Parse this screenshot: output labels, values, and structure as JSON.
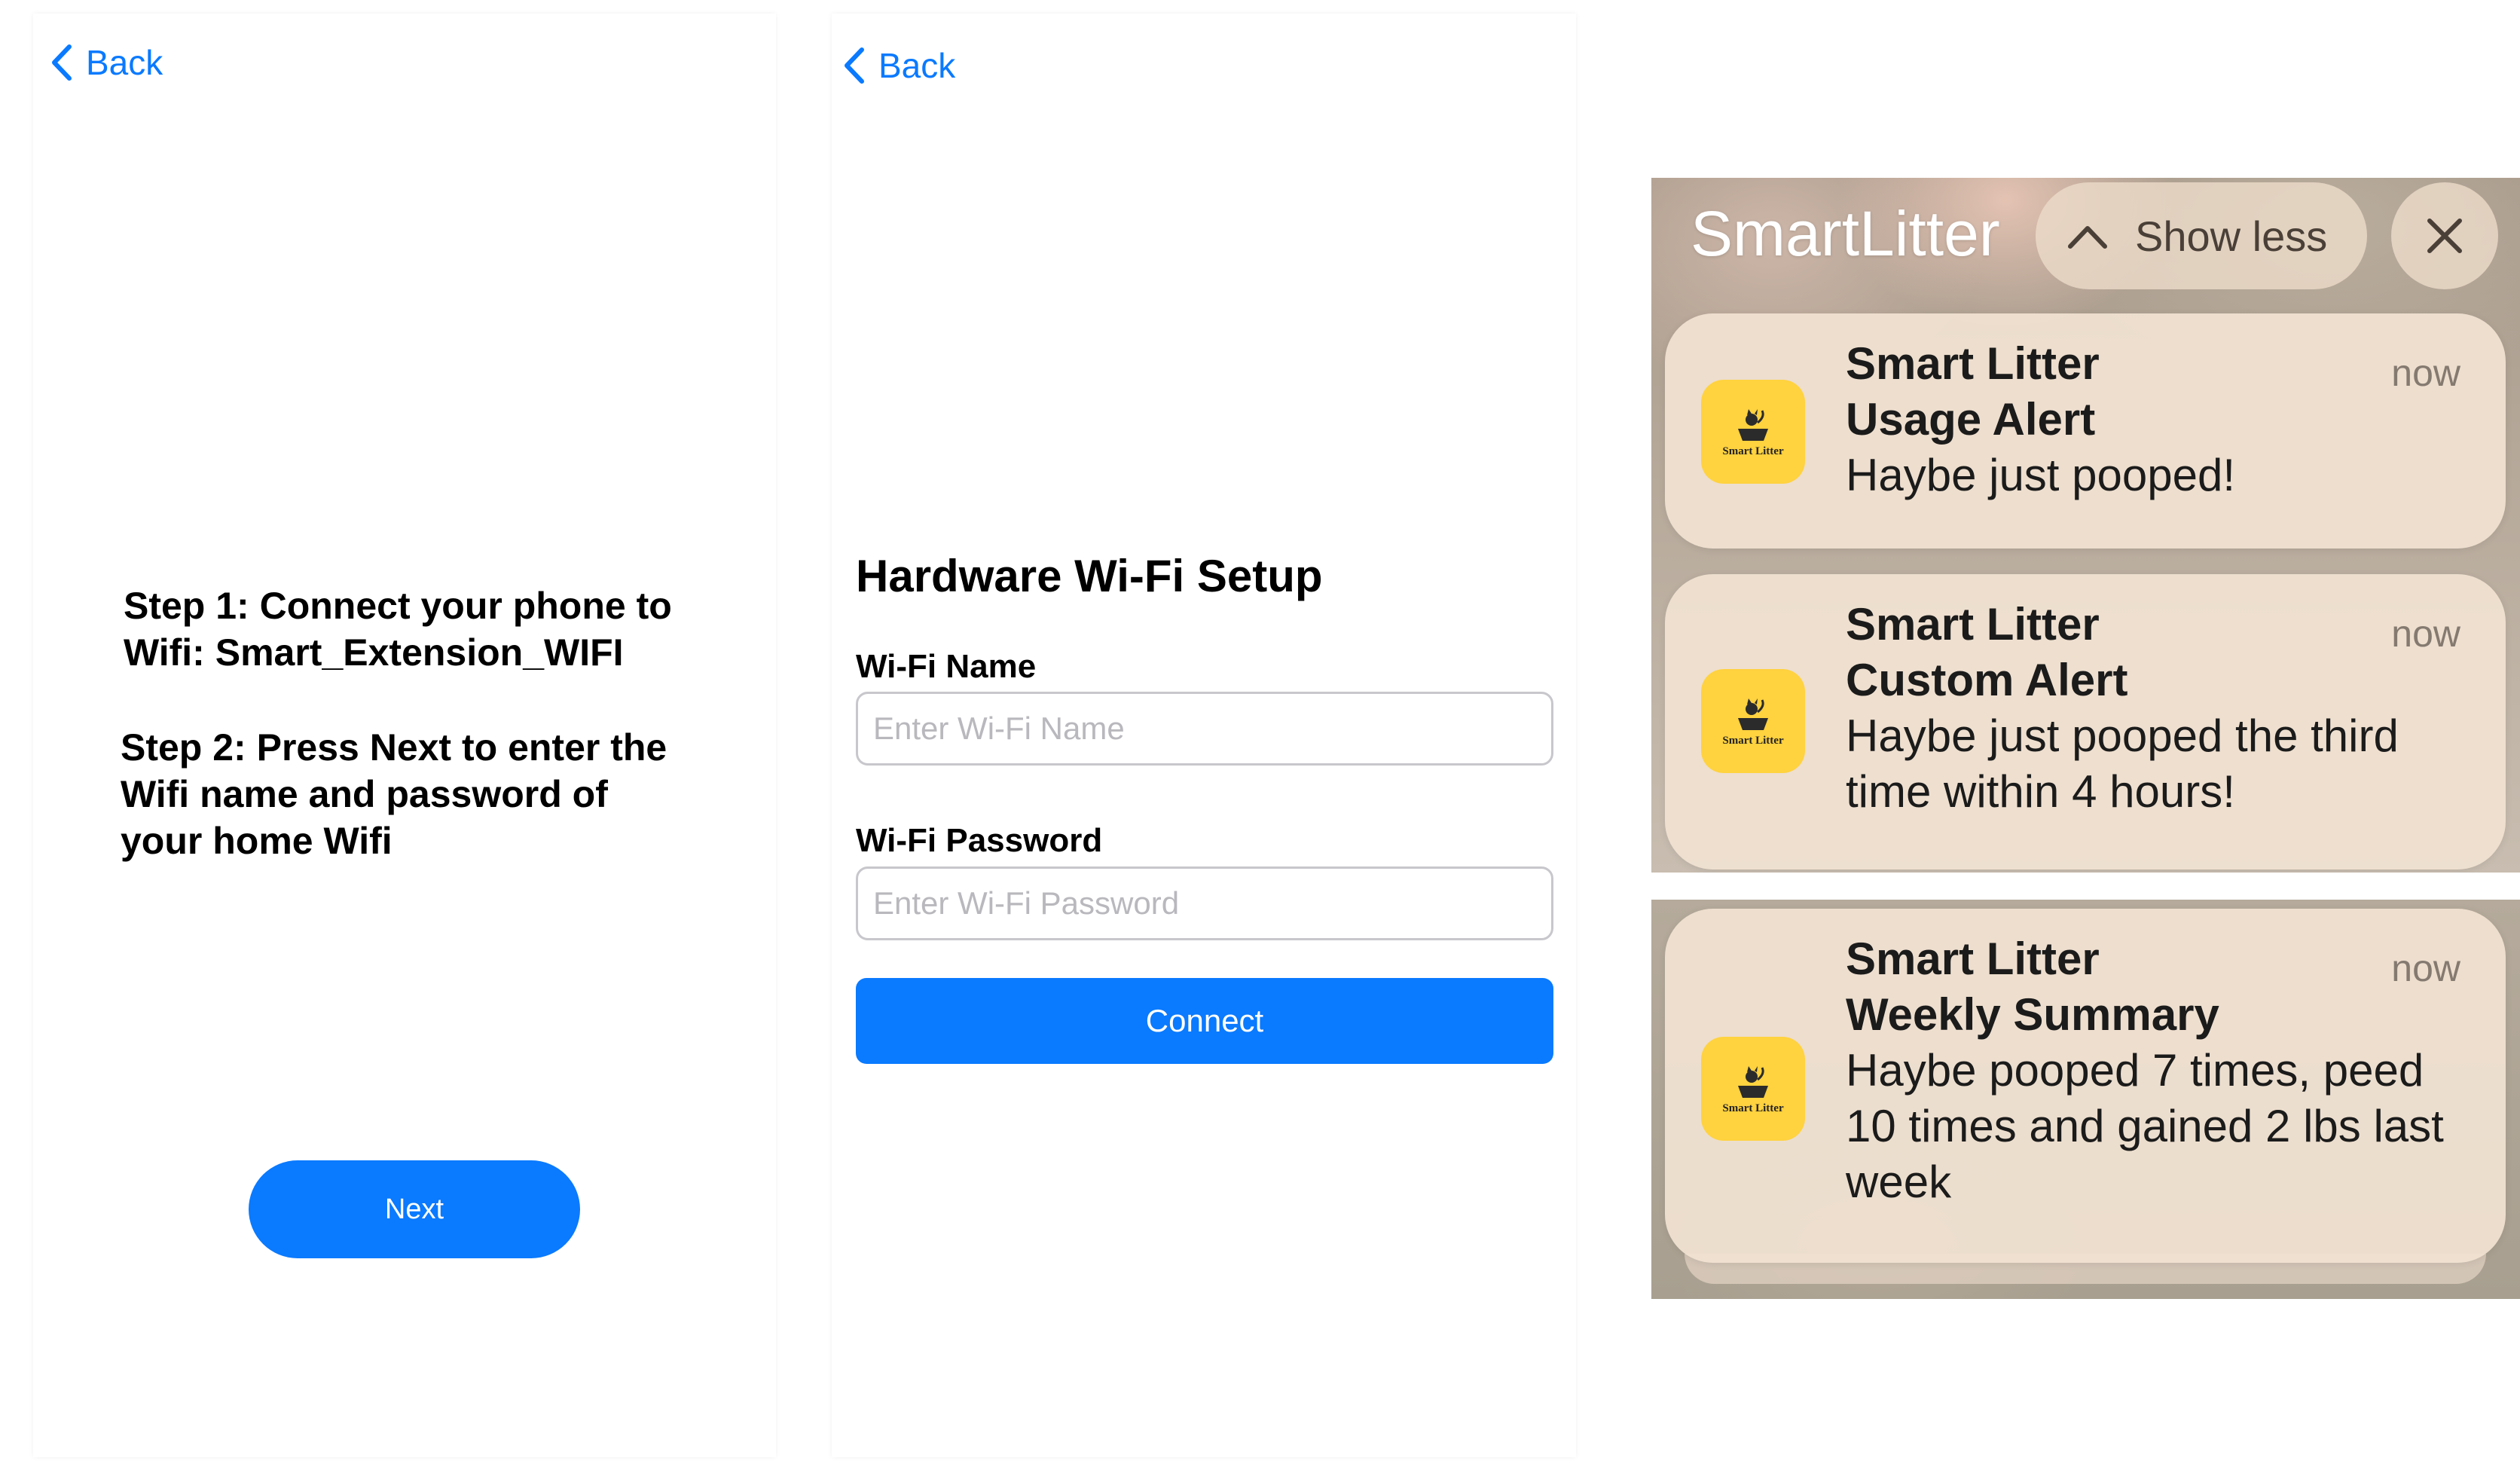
{
  "panel1": {
    "back_label": "Back",
    "step1": "Step 1: Connect your phone to\nWifi: Smart_Extension_WIFI",
    "step2": "Step 2: Press Next to enter the\nWifi name and password of\nyour home Wifi",
    "next_label": "Next"
  },
  "panel2": {
    "back_label": "Back",
    "title": "Hardware Wi-Fi Setup",
    "wifi_name_label": "Wi-Fi Name",
    "wifi_name_placeholder": "Enter Wi-Fi Name",
    "wifi_password_label": "Wi-Fi Password",
    "wifi_password_placeholder": "Enter Wi-Fi Password",
    "connect_label": "Connect"
  },
  "notifications": {
    "app_name": "SmartLitter",
    "show_less_label": "Show less",
    "icon_text": "Smart Litter",
    "items": [
      {
        "app": "Smart Litter",
        "title": "Usage Alert",
        "body": "Haybe just pooped!",
        "time": "now"
      },
      {
        "app": "Smart Litter",
        "title": "Custom Alert",
        "body": "Haybe just pooped the third time within 4 hours!",
        "time": "now"
      },
      {
        "app": "Smart Litter",
        "title": "Weekly Summary",
        "body": "Haybe pooped 7 times, peed 10 times and gained 2 lbs last week",
        "time": "now"
      }
    ]
  },
  "colors": {
    "accent": "#0a7aff",
    "app_icon": "#ffd23f"
  },
  "icons": [
    "chevron-left-icon",
    "chevron-up-icon",
    "close-icon",
    "smart-litter-app-icon"
  ]
}
